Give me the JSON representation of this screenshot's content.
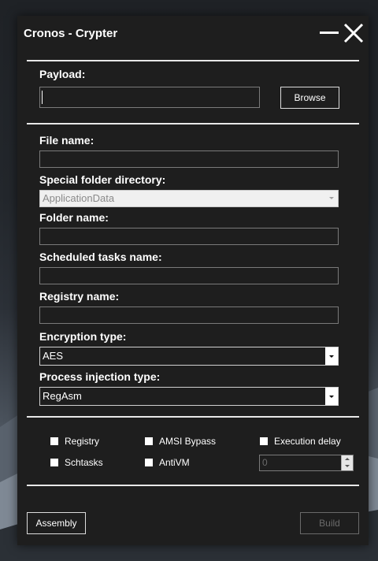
{
  "window": {
    "title": "Cronos - Crypter"
  },
  "payload": {
    "label": "Payload:",
    "value": "",
    "browse_label": "Browse"
  },
  "fields": {
    "file_name": {
      "label": "File name:",
      "value": ""
    },
    "special_folder": {
      "label": "Special folder directory:",
      "selected": "ApplicationData"
    },
    "folder_name": {
      "label": "Folder name:",
      "value": ""
    },
    "scheduled_tasks": {
      "label": "Scheduled tasks name:",
      "value": ""
    },
    "registry_name": {
      "label": "Registry name:",
      "value": ""
    },
    "encryption_type": {
      "label": "Encryption type:",
      "selected": "AES"
    },
    "process_injection": {
      "label": "Process injection type:",
      "selected": "RegAsm"
    }
  },
  "options": {
    "registry": "Registry",
    "schtasks": "Schtasks",
    "amsi_bypass": "AMSI Bypass",
    "antivm": "AntiVM",
    "execution_delay": "Execution delay",
    "delay_value": "0"
  },
  "footer": {
    "assembly_label": "Assembly",
    "build_label": "Build"
  },
  "colors": {
    "window_bg": "#1e1e1e",
    "text": "#ffffff",
    "separator": "#e8e8e8",
    "disabled": "#6a6a6a"
  }
}
